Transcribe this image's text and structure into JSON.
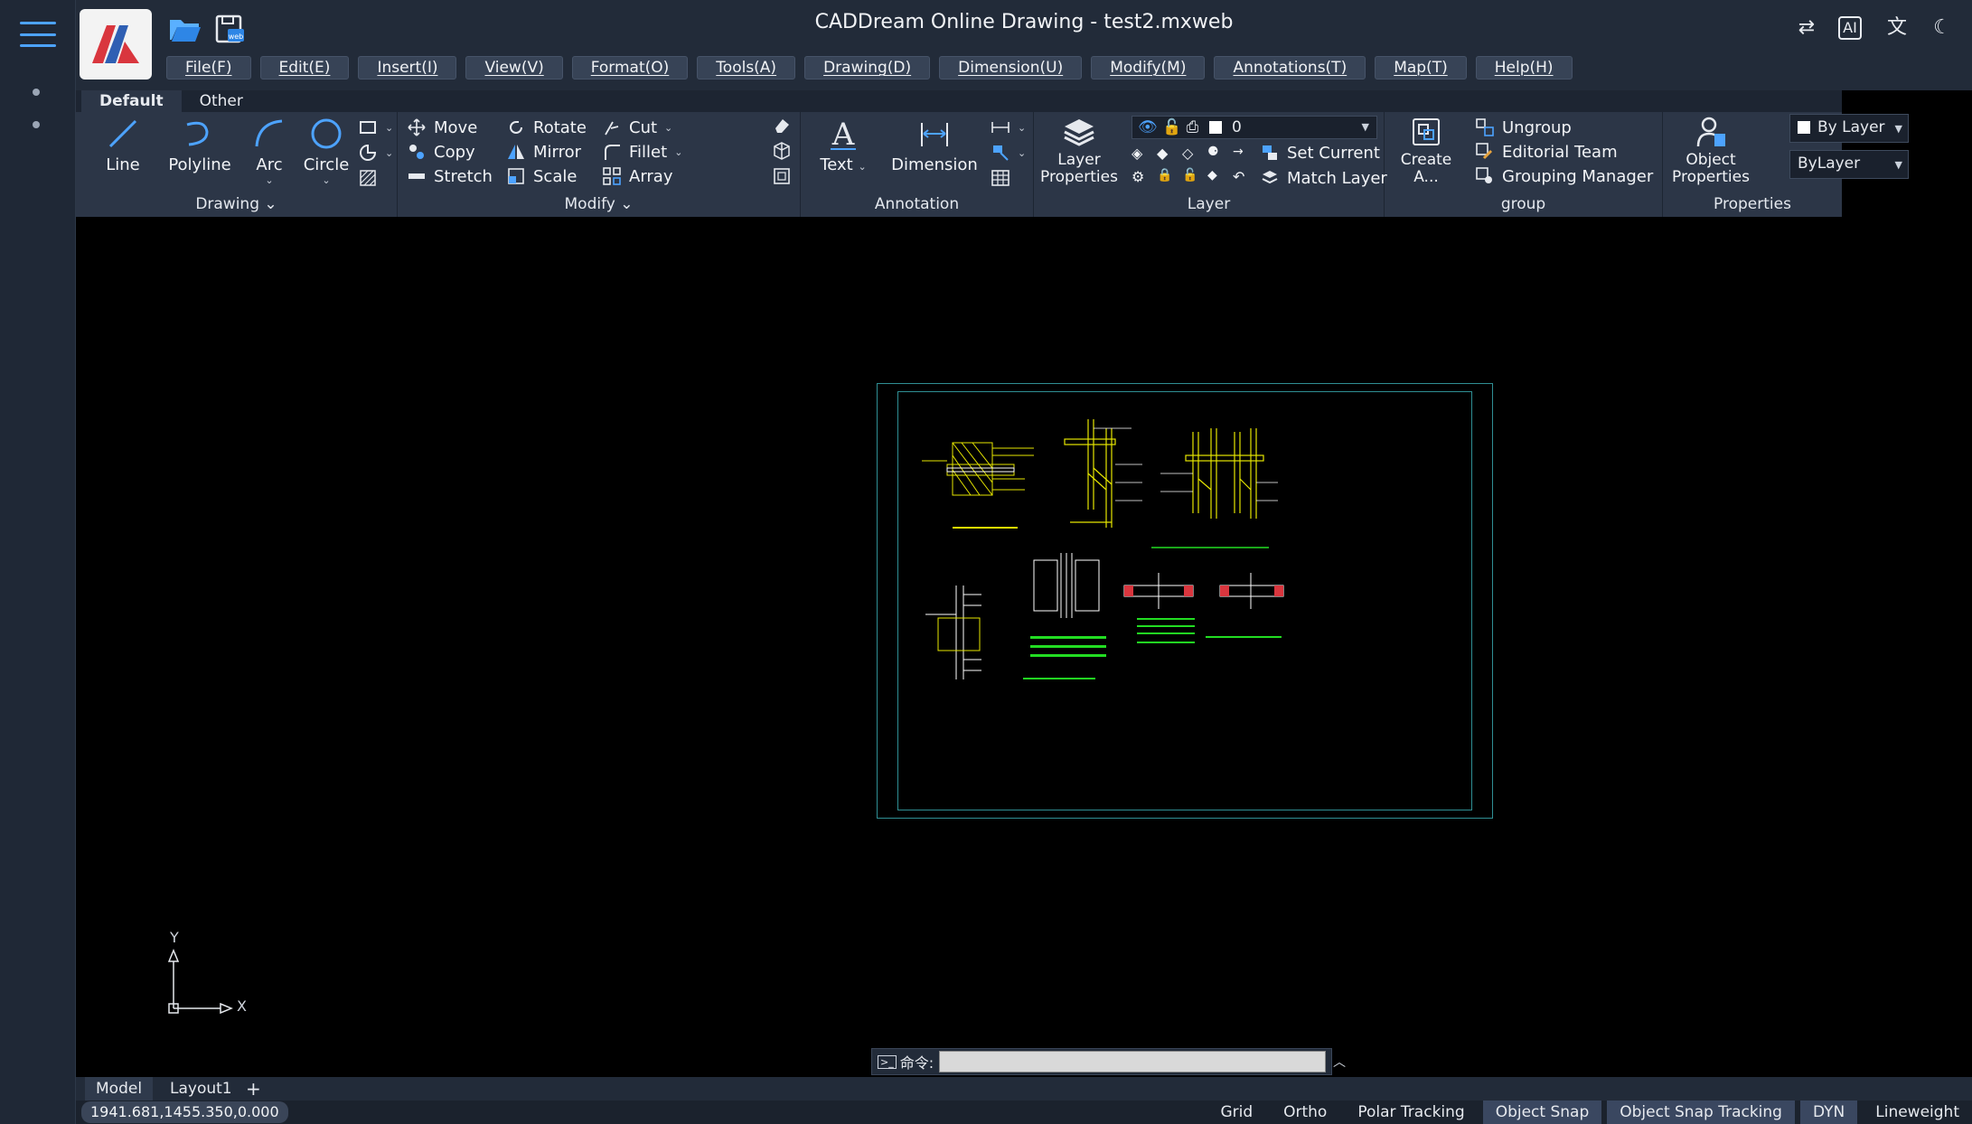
{
  "window": {
    "title": "CADDream Online Drawing - test2.mxweb"
  },
  "menus": [
    "File(F)",
    "Edit(E)",
    "Insert(I)",
    "View(V)",
    "Format(O)",
    "Tools(A)",
    "Drawing(D)",
    "Dimension(U)",
    "Modify(M)",
    "Annotations(T)",
    "Map(T)",
    "Help(H)"
  ],
  "ribbon": {
    "tabs": [
      "Default",
      "Other"
    ],
    "drawing": {
      "label": "Drawing",
      "line": "Line",
      "polyline": "Polyline",
      "arc": "Arc",
      "circle": "Circle"
    },
    "modify": {
      "label": "Modify",
      "move": "Move",
      "copy": "Copy",
      "stretch": "Stretch",
      "rotate": "Rotate",
      "mirror": "Mirror",
      "scale": "Scale",
      "cut": "Cut",
      "fillet": "Fillet",
      "array": "Array"
    },
    "annotation": {
      "label": "Annotation",
      "text": "Text",
      "dimension": "Dimension"
    },
    "layer": {
      "label": "Layer",
      "layer_properties": "Layer Properties",
      "current_layer": "0",
      "set_current": "Set Current",
      "match_layer": "Match Layer"
    },
    "group": {
      "label": "group",
      "create": "Create A...",
      "ungroup": "Ungroup",
      "editorial_team": "Editorial Team",
      "grouping_manager": "Grouping Manager"
    },
    "properties": {
      "label": "Properties",
      "object_properties": "Object Properties",
      "color_value": "By Layer",
      "linetype_value": "ByLayer"
    }
  },
  "canvas": {
    "axis_x": "X",
    "axis_y": "Y",
    "command_label": "命令:",
    "command_value": ""
  },
  "layout_tabs": [
    "Model",
    "Layout1"
  ],
  "add_tab": "+",
  "status": {
    "coordinates": "1941.681,1455.350,0.000",
    "toggles": [
      {
        "label": "Grid",
        "on": false
      },
      {
        "label": "Ortho",
        "on": false
      },
      {
        "label": "Polar Tracking",
        "on": false
      },
      {
        "label": "Object Snap",
        "on": true
      },
      {
        "label": "Object Snap Tracking",
        "on": true
      },
      {
        "label": "DYN",
        "on": true
      },
      {
        "label": "Lineweight",
        "on": false
      }
    ]
  },
  "colors": {
    "accent": "#4da3ff",
    "drawing_frame": "#2f8f94",
    "drawing_yellow": "#e6e600",
    "drawing_green": "#22dd22"
  }
}
